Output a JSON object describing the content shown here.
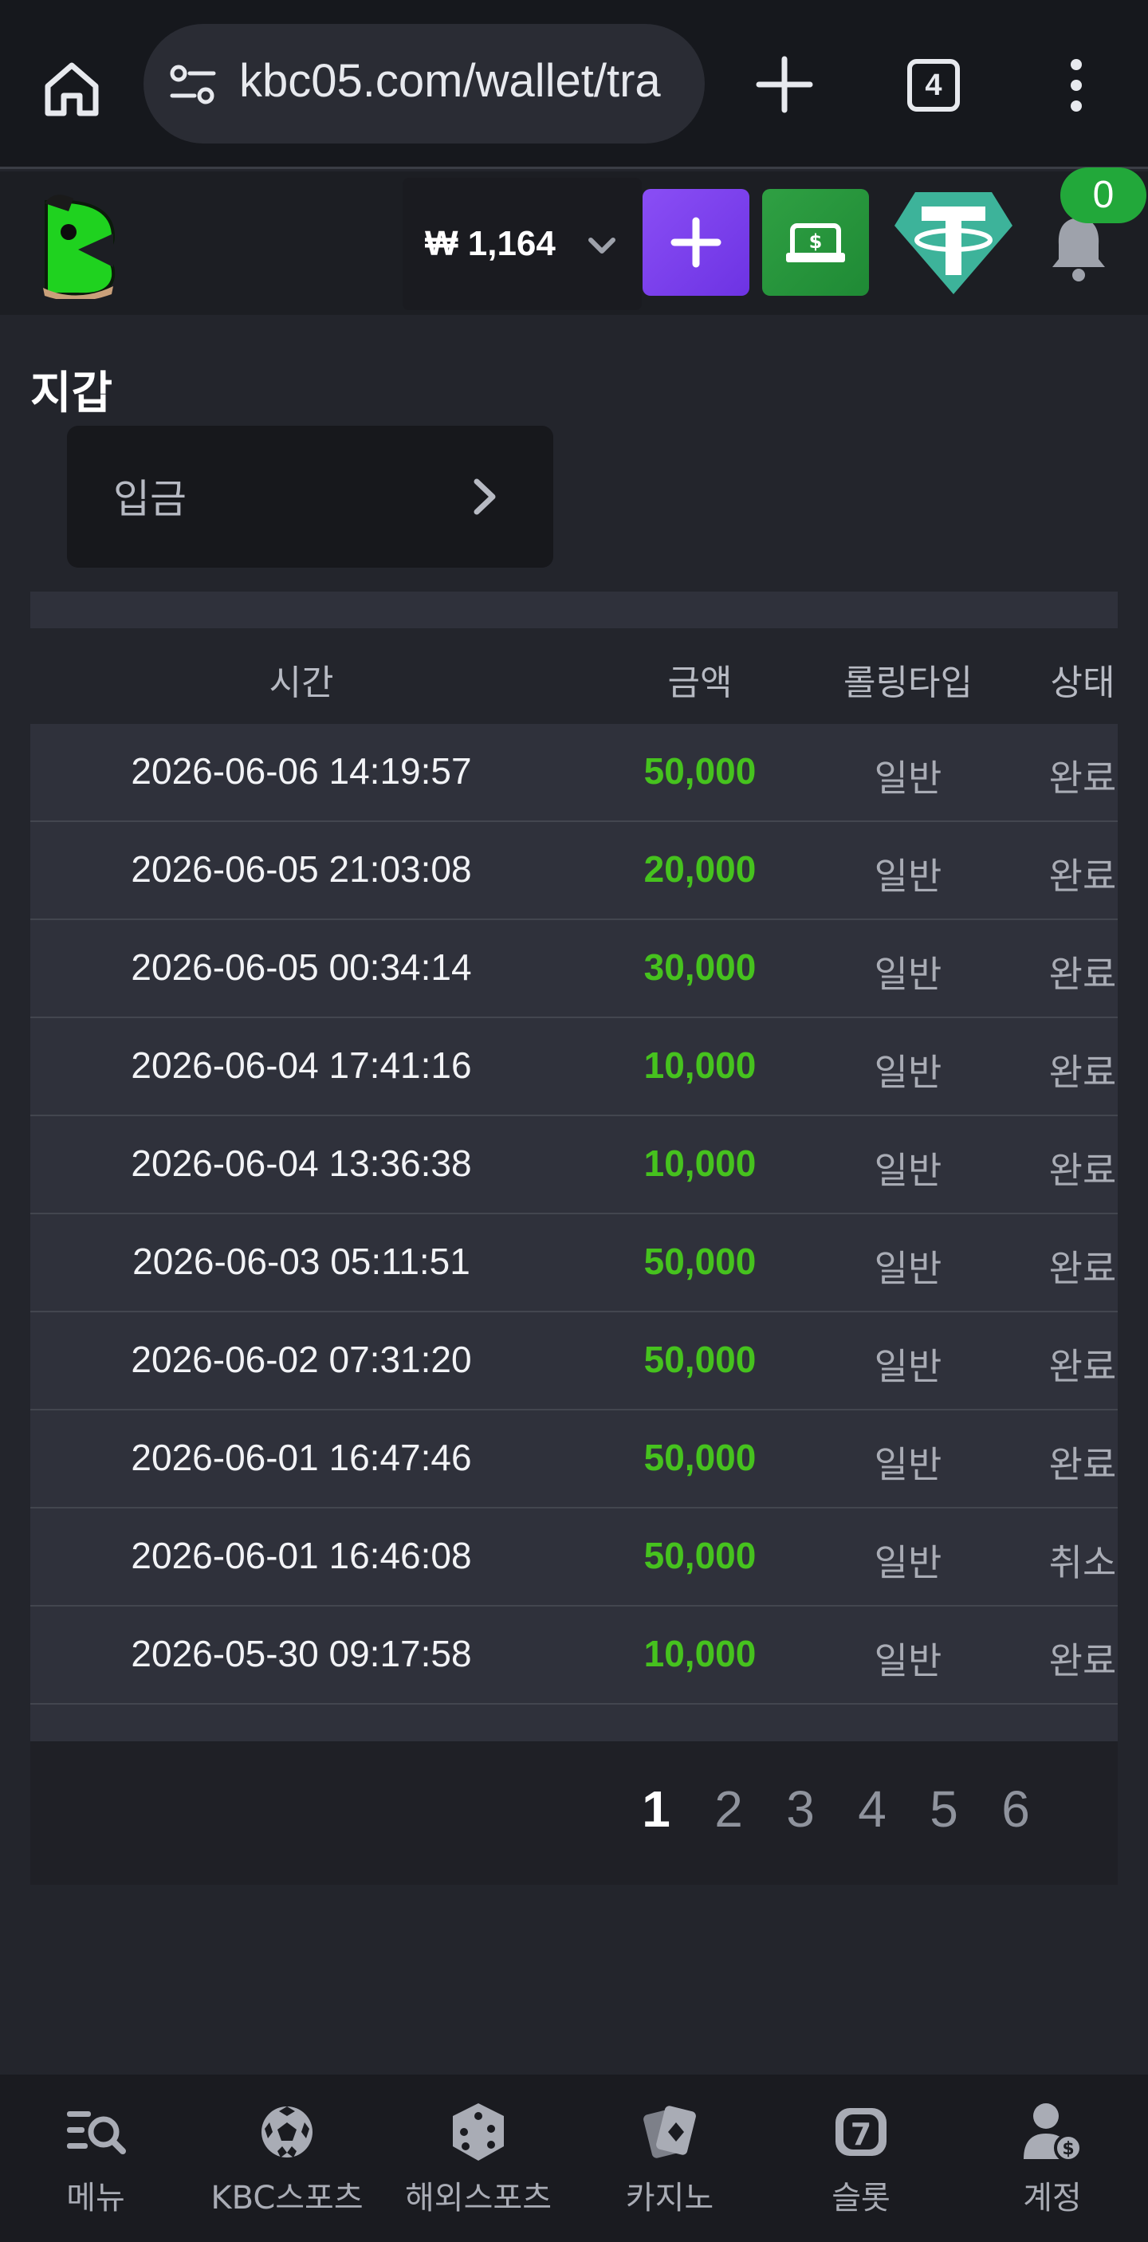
{
  "browser": {
    "url": "kbc05.com/wallet/tra",
    "tab_count": "4"
  },
  "header": {
    "balance": "₩ 1,164",
    "notification_count": "0"
  },
  "page": {
    "title": "지갑",
    "deposit_tab": "입금"
  },
  "table": {
    "headers": [
      "시간",
      "금액",
      "롤링타입",
      "상태"
    ],
    "rows": [
      {
        "time": "2026-06-06 14:19:57",
        "amount": "50,000",
        "type": "일반",
        "status": "완료"
      },
      {
        "time": "2026-06-05 21:03:08",
        "amount": "20,000",
        "type": "일반",
        "status": "완료"
      },
      {
        "time": "2026-06-05 00:34:14",
        "amount": "30,000",
        "type": "일반",
        "status": "완료"
      },
      {
        "time": "2026-06-04 17:41:16",
        "amount": "10,000",
        "type": "일반",
        "status": "완료"
      },
      {
        "time": "2026-06-04 13:36:38",
        "amount": "10,000",
        "type": "일반",
        "status": "완료"
      },
      {
        "time": "2026-06-03 05:11:51",
        "amount": "50,000",
        "type": "일반",
        "status": "완료"
      },
      {
        "time": "2026-06-02 07:31:20",
        "amount": "50,000",
        "type": "일반",
        "status": "완료"
      },
      {
        "time": "2026-06-01 16:47:46",
        "amount": "50,000",
        "type": "일반",
        "status": "완료"
      },
      {
        "time": "2026-06-01 16:46:08",
        "amount": "50,000",
        "type": "일반",
        "status": "취소"
      },
      {
        "time": "2026-05-30 09:17:58",
        "amount": "10,000",
        "type": "일반",
        "status": "완료"
      }
    ]
  },
  "pagination": {
    "pages": [
      "1",
      "2",
      "3",
      "4",
      "5",
      "6"
    ],
    "current": "1"
  },
  "bottom_nav": {
    "items": [
      {
        "label": "메뉴",
        "icon": "menu-search-icon"
      },
      {
        "label": "KBC스포츠",
        "icon": "soccer-ball-icon"
      },
      {
        "label": "해외스포츠",
        "icon": "dice-icon"
      },
      {
        "label": "카지노",
        "icon": "cards-icon"
      },
      {
        "label": "슬롯",
        "icon": "slot-seven-icon"
      },
      {
        "label": "계정",
        "icon": "account-icon"
      }
    ]
  },
  "colors": {
    "amount_green": "#46c21e",
    "deposit_purple": "#7a3ff0",
    "cash_green": "#27973c",
    "tether_teal": "#3db39a",
    "badge_green": "#22a83a"
  }
}
